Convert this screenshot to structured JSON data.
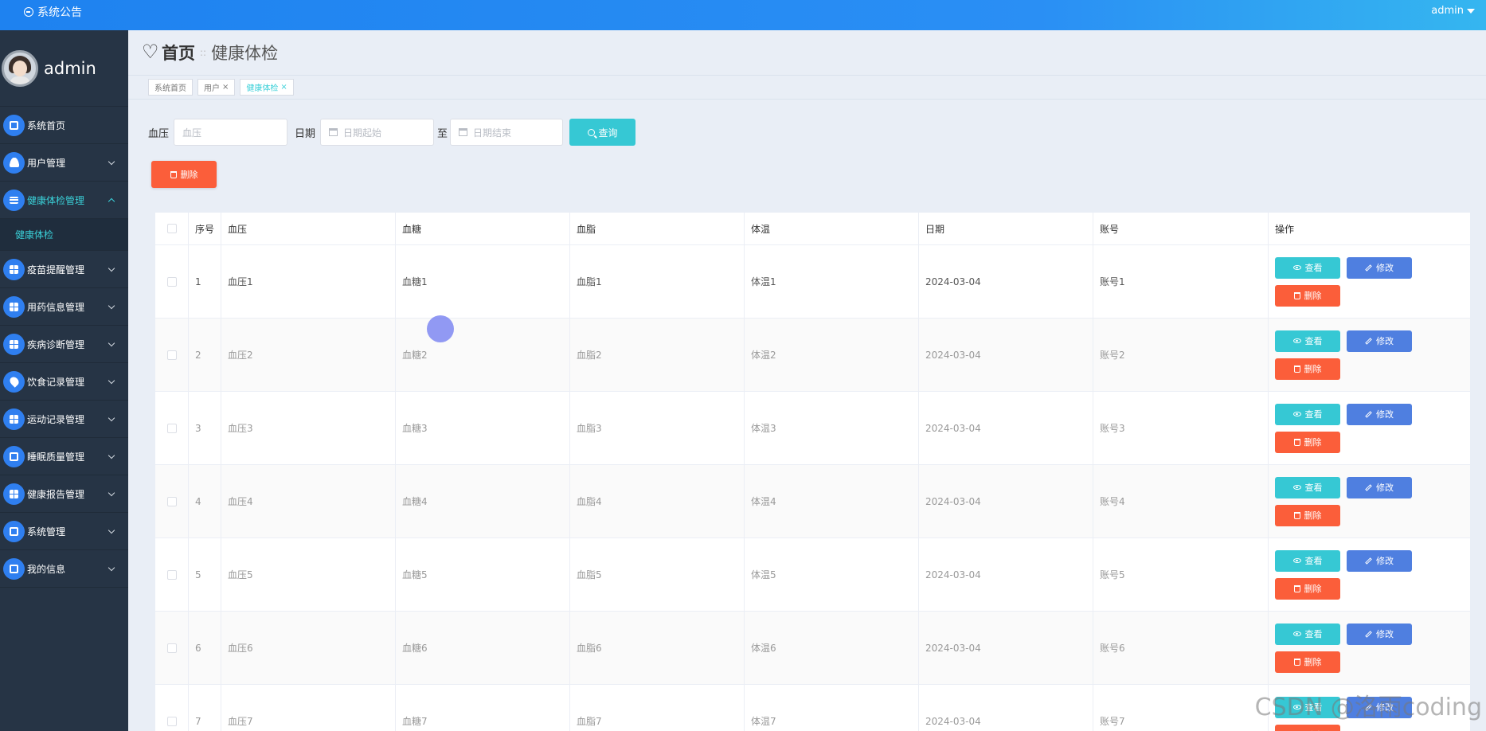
{
  "topbar": {
    "notice": "系统公告",
    "user": "admin"
  },
  "sidebar": {
    "username": "admin",
    "items": [
      {
        "label": "系统首页",
        "icon": "home-icon"
      },
      {
        "label": "用户管理",
        "icon": "user-icon"
      },
      {
        "label": "健康体检管理",
        "icon": "list-icon",
        "active": true
      },
      {
        "label": "疫苗提醒管理",
        "icon": "grid-icon"
      },
      {
        "label": "用药信息管理",
        "icon": "grid-icon"
      },
      {
        "label": "疾病诊断管理",
        "icon": "grid-icon"
      },
      {
        "label": "饮食记录管理",
        "icon": "drop-icon"
      },
      {
        "label": "运动记录管理",
        "icon": "grid-icon"
      },
      {
        "label": "睡眠质量管理",
        "icon": "ticket-icon"
      },
      {
        "label": "健康报告管理",
        "icon": "grid-icon"
      },
      {
        "label": "系统管理",
        "icon": "puzzle-icon"
      },
      {
        "label": "我的信息",
        "icon": "card-icon"
      }
    ],
    "submenu": "健康体检"
  },
  "page": {
    "home": "首页",
    "separator": "::",
    "current": "健康体检"
  },
  "tags": [
    {
      "label": "系统首页"
    },
    {
      "label": "用户",
      "close": "×"
    },
    {
      "label": "健康体检",
      "close": "×",
      "active": true
    }
  ],
  "search": {
    "bp_label": "血压",
    "bp_placeholder": "血压",
    "date_label": "日期",
    "date_start_placeholder": "日期起始",
    "to_label": "至",
    "date_end_placeholder": "日期结束",
    "query_button": "查询"
  },
  "toolbar": {
    "delete_button": "删除"
  },
  "table": {
    "headers": {
      "no": "序号",
      "bp": "血压",
      "sugar": "血糖",
      "lipid": "血脂",
      "temp": "体温",
      "date": "日期",
      "account": "账号",
      "ops": "操作"
    },
    "actions": {
      "view": "查看",
      "edit": "修改",
      "delete": "删除"
    },
    "rows": [
      {
        "no": "1",
        "bp": "血压1",
        "sugar": "血糖1",
        "lipid": "血脂1",
        "temp": "体温1",
        "date": "2024-03-04",
        "account": "账号1"
      },
      {
        "no": "2",
        "bp": "血压2",
        "sugar": "血糖2",
        "lipid": "血脂2",
        "temp": "体温2",
        "date": "2024-03-04",
        "account": "账号2"
      },
      {
        "no": "3",
        "bp": "血压3",
        "sugar": "血糖3",
        "lipid": "血脂3",
        "temp": "体温3",
        "date": "2024-03-04",
        "account": "账号3"
      },
      {
        "no": "4",
        "bp": "血压4",
        "sugar": "血糖4",
        "lipid": "血脂4",
        "temp": "体温4",
        "date": "2024-03-04",
        "account": "账号4"
      },
      {
        "no": "5",
        "bp": "血压5",
        "sugar": "血糖5",
        "lipid": "血脂5",
        "temp": "体温5",
        "date": "2024-03-04",
        "account": "账号5"
      },
      {
        "no": "6",
        "bp": "血压6",
        "sugar": "血糖6",
        "lipid": "血脂6",
        "temp": "体温6",
        "date": "2024-03-04",
        "account": "账号6"
      },
      {
        "no": "7",
        "bp": "血压7",
        "sugar": "血糖7",
        "lipid": "血脂7",
        "temp": "体温7",
        "date": "2024-03-04",
        "account": "账号7"
      }
    ]
  },
  "watermark": "CSDN @洛雨coding",
  "colors": {
    "accent": "#36c8d4",
    "primary": "#2f7ff0",
    "danger": "#fb5e3a",
    "edit": "#4f7fe0",
    "sidebar": "#263445"
  }
}
